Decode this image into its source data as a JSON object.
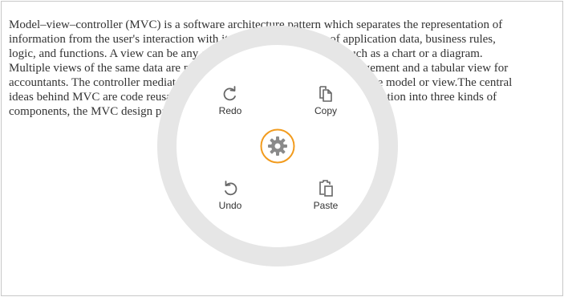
{
  "document": {
    "lines": [
      "Model–view–controller (MVC) is a software architecture pattern which separates the representation of",
      "information from the user's interaction with it. The model consists of application data, business rules,",
      "logic, and functions. A view can be any output representation of data, such as a chart or a diagram.",
      "Multiple views of the same data are possible, such as a bar chart for management and a tabular view for",
      "accountants. The controller mediates input, converting it to commands for the model or view.The central",
      "ideas behind MVC are code reusability and separation of concerns, the application into three kinds of",
      "components, the MVC design pattern defines the interactions between them."
    ]
  },
  "radial_menu": {
    "items": [
      {
        "label": "Redo",
        "icon": "redo-icon"
      },
      {
        "label": "Copy",
        "icon": "copy-icon"
      },
      {
        "label": "Undo",
        "icon": "undo-icon"
      },
      {
        "label": "Paste",
        "icon": "paste-icon"
      }
    ],
    "center_icon": "gear-icon",
    "colors": {
      "ring": "#e6e6e6",
      "center_ring": "#f29b1d",
      "gear": "#8a8a8a",
      "icon": "#666666"
    }
  }
}
